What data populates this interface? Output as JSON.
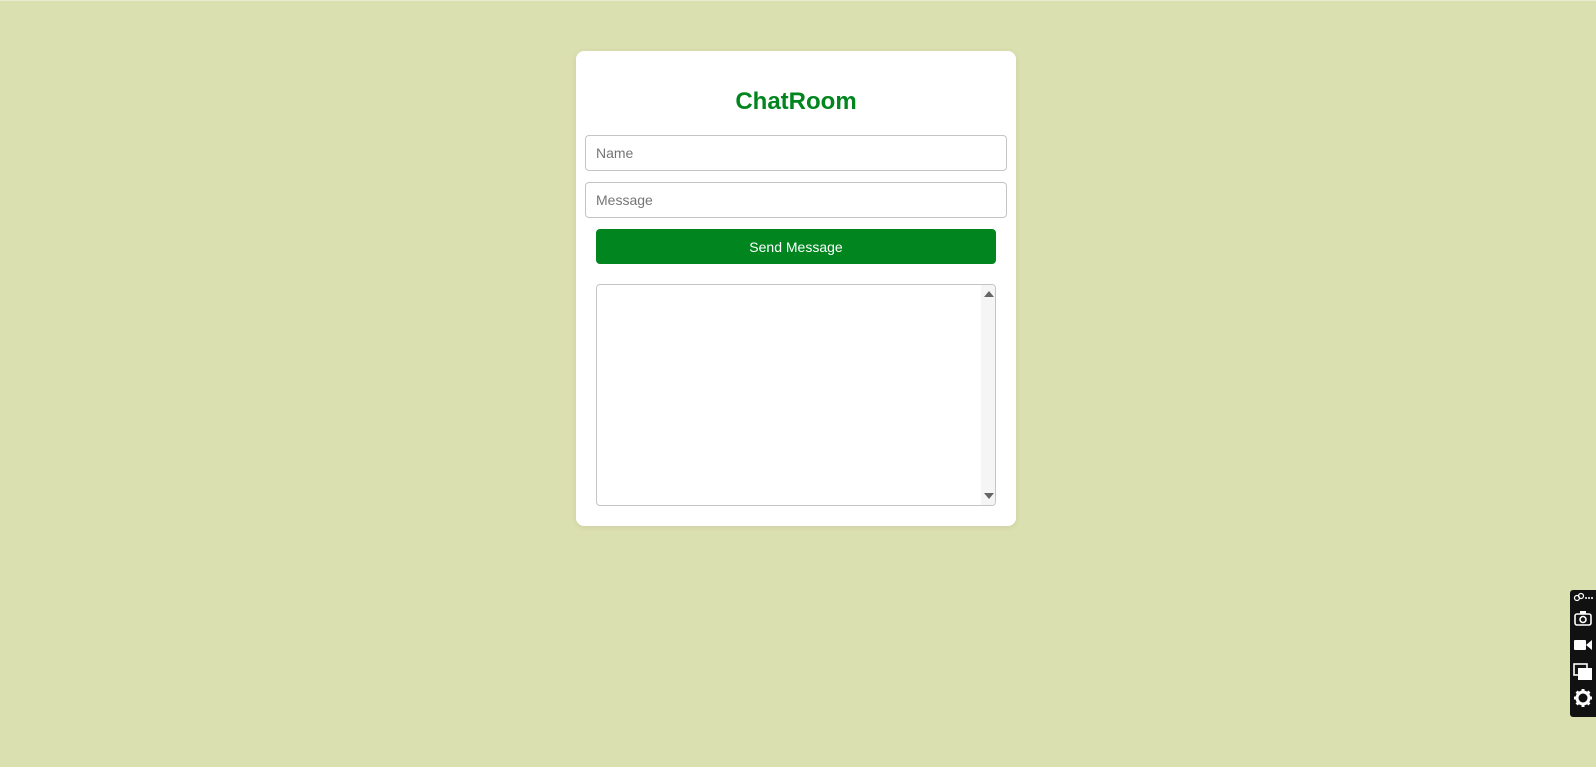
{
  "app": {
    "title": "ChatRoom"
  },
  "form": {
    "name_placeholder": "Name",
    "message_placeholder": "Message",
    "send_label": "Send Message"
  },
  "messages": [],
  "colors": {
    "background": "#dbe0b0",
    "accent": "#00851f",
    "card": "#ffffff"
  },
  "side_widget": {
    "icons": [
      "link-icon",
      "more-icon",
      "camera-icon",
      "video-icon",
      "window-icon",
      "gear-icon"
    ]
  }
}
